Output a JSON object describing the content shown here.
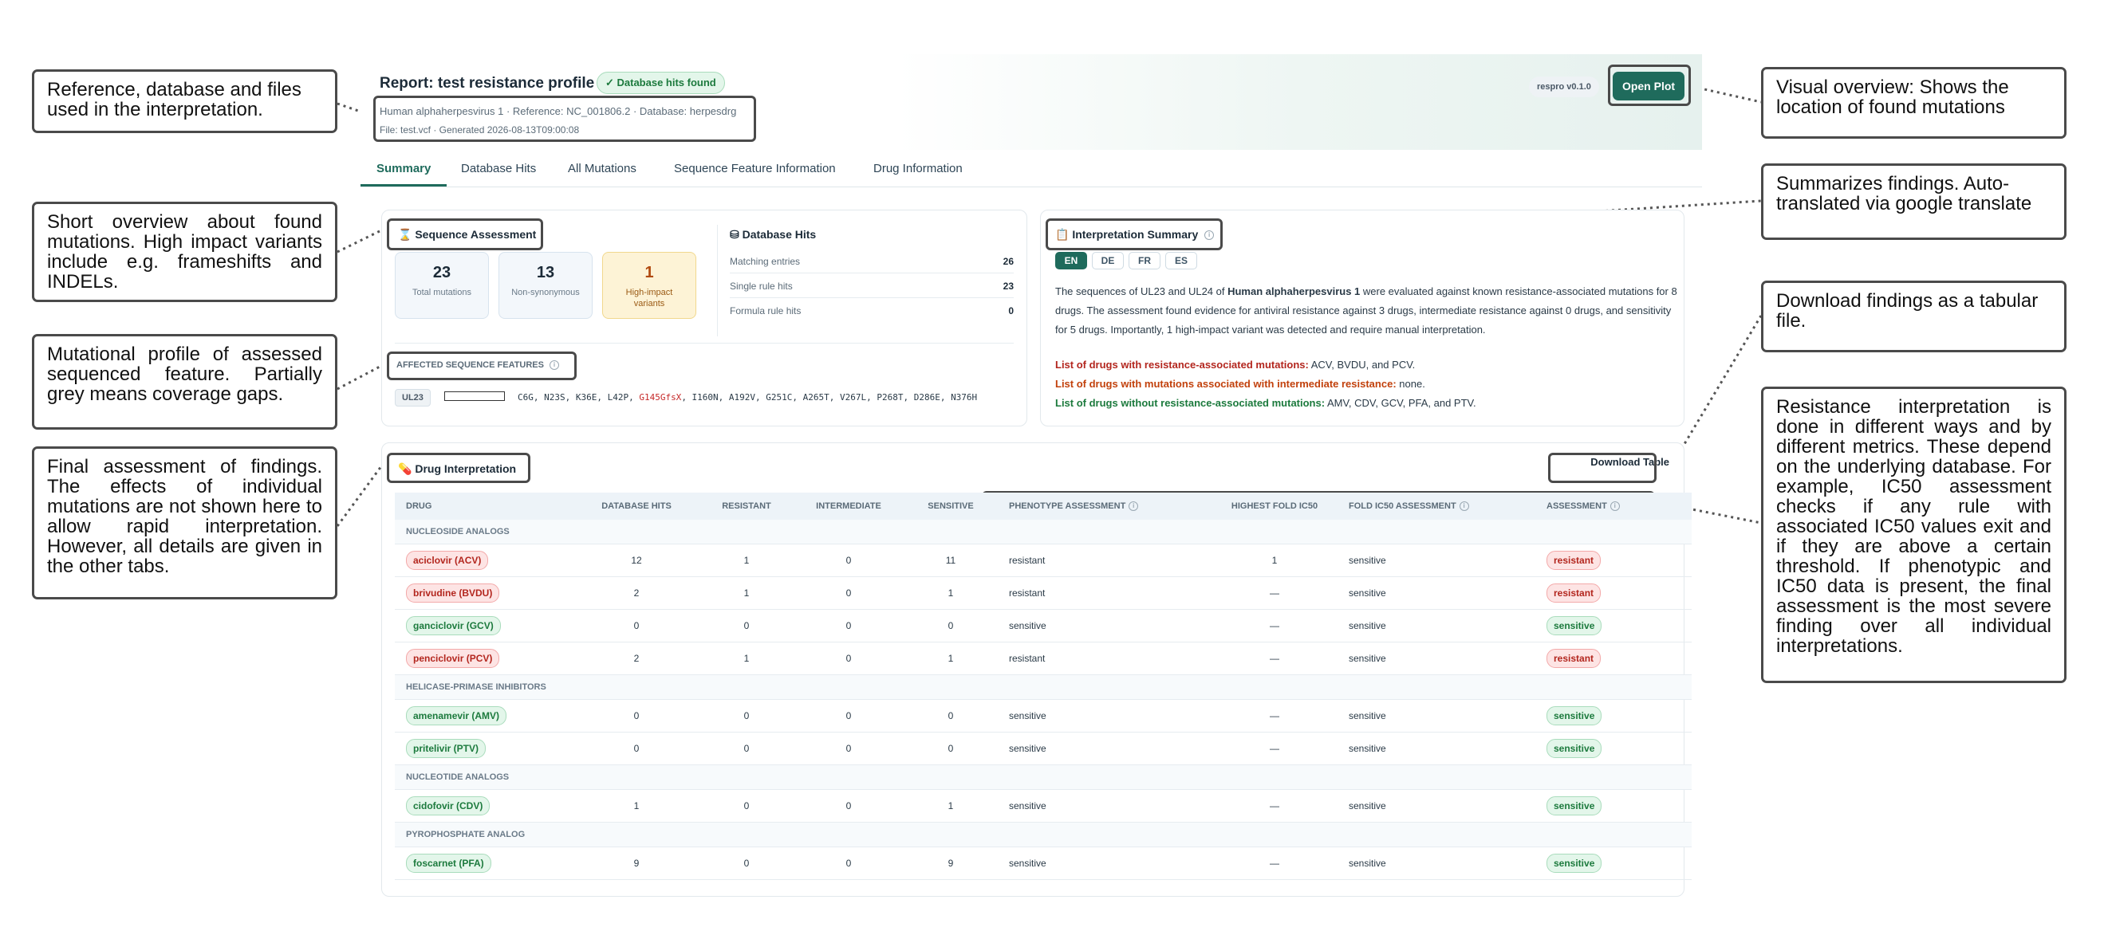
{
  "callouts": {
    "reference": "Reference, database and files used in the interpretation.",
    "overview": "Short overview about found mutations. High impact variants include e.g. frameshifts and INDELs.",
    "profile": "Mutational profile of assessed sequenced feature. Partially grey means coverage gaps.",
    "final": "Final assessment of findings. The effects of individual mutations are not shown here to allow rapid interpretation. However, all details are given in the other tabs.",
    "visual": "Visual overview: Shows the location of found mutations",
    "summarizes": "Summarizes findings. Auto-translated via google translate",
    "download": "Download findings as a tabular file.",
    "resistance": "Resistance interpretation is done in different ways and by different metrics. These depend on the underlying database. For example, IC50 assessment checks if any rule with associated IC50 values exit and if they are above a certain threshold. If phenotypic and IC50 data is present, the final assessment is the most severe finding over all individual interpretations."
  },
  "header": {
    "title": "Report: test resistance profile",
    "db_badge": "✓ Database hits found",
    "reference_line": "Human alphaherpesvirus 1 · Reference: NC_001806.2 · Database: herpesdrg",
    "file_line": "File: test.vcf · Generated 2026-08-13T09:00:08",
    "version": "respro v0.1.0",
    "open_plot": "Open Plot"
  },
  "tabs": [
    "Summary",
    "Database Hits",
    "All Mutations",
    "Sequence Feature Information",
    "Drug Information"
  ],
  "sequence_assessment": {
    "title": "Sequence Assessment",
    "stats": [
      {
        "value": "23",
        "label": "Total mutations"
      },
      {
        "value": "13",
        "label": "Non-synonymous"
      },
      {
        "value": "1",
        "label": "High-impact variants"
      }
    ]
  },
  "database_hits": {
    "title": "Database Hits",
    "rows": [
      {
        "label": "Matching entries",
        "value": "26"
      },
      {
        "label": "Single rule hits",
        "value": "23"
      },
      {
        "label": "Formula rule hits",
        "value": "0"
      }
    ]
  },
  "affected_features": {
    "title": "AFFECTED SEQUENCE FEATURES",
    "feature": "UL23",
    "mutations_before": "C6G, N23S, K36E, L42P, ",
    "mutation_highlight": "G145GfsX",
    "mutations_after": ", I160N, A192V, G251C, A265T, V267L, P268T, D286E, N376H"
  },
  "interpretation_summary": {
    "title": "Interpretation Summary",
    "languages": [
      "EN",
      "DE",
      "FR",
      "ES"
    ],
    "active_language": "EN",
    "text_pre": "The sequences of UL23 and UL24 of ",
    "text_bold": "Human alphaherpesvirus 1",
    "text_post": " were evaluated against known resistance-associated mutations for 8 drugs. The assessment found evidence for antiviral resistance against 3 drugs, intermediate resistance against 0 drugs, and sensitivity for 5 drugs. Importantly, 1 high-impact variant was detected and require manual interpretation.",
    "resistance_label": "List of drugs with resistance-associated mutations:",
    "resistance_value": " ACV, BVDU, and PCV.",
    "intermediate_label": "List of drugs with mutations associated with intermediate resistance:",
    "intermediate_value": " none.",
    "none_label": "List of drugs without resistance-associated mutations:",
    "none_value": " AMV, CDV, GCV, PFA, and PTV."
  },
  "drug_interpretation": {
    "title": "Drug Interpretation",
    "download_label": "Download Table",
    "columns": [
      "DRUG",
      "DATABASE HITS",
      "RESISTANT",
      "INTERMEDIATE",
      "SENSITIVE",
      "PHENOTYPE ASSESSMENT",
      "HIGHEST FOLD IC50",
      "FOLD IC50 ASSESSMENT",
      "ASSESSMENT"
    ],
    "groups": [
      {
        "name": "NUCLEOSIDE ANALOGS",
        "rows": [
          {
            "drug": "aciclovir (ACV)",
            "hits": "12",
            "resistant": "1",
            "intermediate": "0",
            "sensitive": "11",
            "phenotype": "resistant",
            "fold": "1",
            "fold_assessment": "sensitive",
            "assessment": "resistant"
          },
          {
            "drug": "brivudine (BVDU)",
            "hits": "2",
            "resistant": "1",
            "intermediate": "0",
            "sensitive": "1",
            "phenotype": "resistant",
            "fold": "—",
            "fold_assessment": "sensitive",
            "assessment": "resistant"
          },
          {
            "drug": "ganciclovir (GCV)",
            "hits": "0",
            "resistant": "0",
            "intermediate": "0",
            "sensitive": "0",
            "phenotype": "sensitive",
            "fold": "—",
            "fold_assessment": "sensitive",
            "assessment": "sensitive"
          },
          {
            "drug": "penciclovir (PCV)",
            "hits": "2",
            "resistant": "1",
            "intermediate": "0",
            "sensitive": "1",
            "phenotype": "resistant",
            "fold": "—",
            "fold_assessment": "sensitive",
            "assessment": "resistant"
          }
        ]
      },
      {
        "name": "HELICASE-PRIMASE INHIBITORS",
        "rows": [
          {
            "drug": "amenamevir (AMV)",
            "hits": "0",
            "resistant": "0",
            "intermediate": "0",
            "sensitive": "0",
            "phenotype": "sensitive",
            "fold": "—",
            "fold_assessment": "sensitive",
            "assessment": "sensitive"
          },
          {
            "drug": "pritelivir (PTV)",
            "hits": "0",
            "resistant": "0",
            "intermediate": "0",
            "sensitive": "0",
            "phenotype": "sensitive",
            "fold": "—",
            "fold_assessment": "sensitive",
            "assessment": "sensitive"
          }
        ]
      },
      {
        "name": "NUCLEOTIDE ANALOGS",
        "rows": [
          {
            "drug": "cidofovir (CDV)",
            "hits": "1",
            "resistant": "0",
            "intermediate": "0",
            "sensitive": "1",
            "phenotype": "sensitive",
            "fold": "—",
            "fold_assessment": "sensitive",
            "assessment": "sensitive"
          }
        ]
      },
      {
        "name": "PYROPHOSPHATE ANALOG",
        "rows": [
          {
            "drug": "foscarnet (PFA)",
            "hits": "9",
            "resistant": "0",
            "intermediate": "0",
            "sensitive": "9",
            "phenotype": "sensitive",
            "fold": "—",
            "fold_assessment": "sensitive",
            "assessment": "sensitive"
          }
        ]
      }
    ]
  }
}
